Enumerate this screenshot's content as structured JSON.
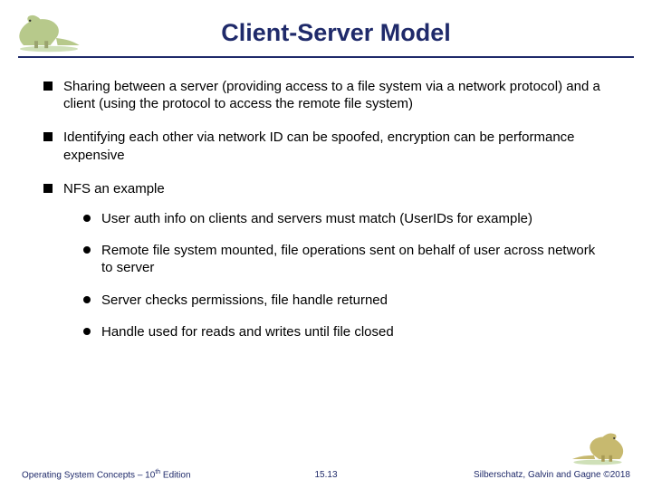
{
  "title": "Client-Server Model",
  "bullets": {
    "b1": "Sharing between a server (providing access to a file system via a network protocol) and a client (using the protocol to access the remote file system)",
    "b2": "Identifying each other via network ID can be spoofed, encryption can be performance expensive",
    "b3": "NFS an example",
    "b3_sub": {
      "s1": "User auth info on clients and servers must match (UserIDs for example)",
      "s2": "Remote file system mounted, file operations sent on behalf of user across network to server",
      "s3": "Server checks permissions, file handle returned",
      "s4": "Handle used for reads and writes until file closed"
    }
  },
  "footer": {
    "left_prefix": "Operating System Concepts – 10",
    "left_sup": "th",
    "left_suffix": " Edition",
    "center": "15.13",
    "right": "Silberschatz, Galvin and Gagne ©2018"
  },
  "icons": {
    "dino_left": "dinosaur-left-icon",
    "dino_right": "dinosaur-right-icon"
  }
}
